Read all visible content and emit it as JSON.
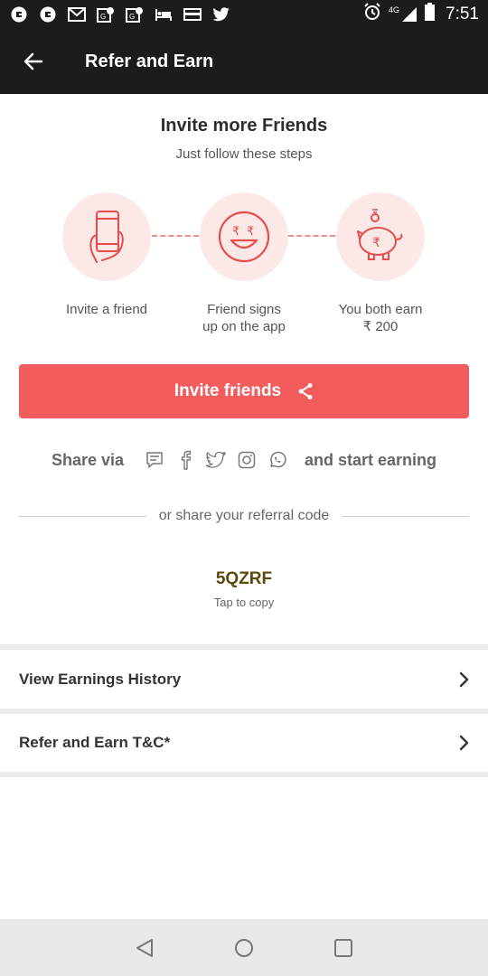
{
  "status_bar": {
    "time": "7:51",
    "network": "4G",
    "icons": [
      "uber-icon",
      "uber-icon",
      "gmail-icon",
      "maps-icon",
      "maps-icon",
      "hotel-icon",
      "card-icon",
      "twitter-icon"
    ]
  },
  "app_bar": {
    "title": "Refer and Earn"
  },
  "intro": {
    "heading": "Invite more Friends",
    "subheading": "Just follow these steps"
  },
  "steps": [
    {
      "label_line1": "Invite a friend",
      "label_line2": ""
    },
    {
      "label_line1": "Friend signs",
      "label_line2": "up on the app"
    },
    {
      "label_line1": "You both earn",
      "label_line2": "₹ 200"
    }
  ],
  "invite_button": {
    "label": "Invite friends"
  },
  "share": {
    "prefix": "Share via",
    "suffix": "and start earning",
    "channels": [
      "message-icon",
      "facebook-icon",
      "twitter-icon",
      "instagram-icon",
      "whatsapp-icon"
    ]
  },
  "referral": {
    "divider_text": "or share your referral code",
    "code": "5QZRF",
    "hint": "Tap to copy"
  },
  "menu": [
    {
      "label": "View Earnings History"
    },
    {
      "label": "Refer and Earn T&C*"
    }
  ],
  "colors": {
    "accent": "#f25c5c",
    "step_bg": "#fde8e8",
    "code": "#5b4a0d",
    "bar": "#1c1c1c"
  }
}
